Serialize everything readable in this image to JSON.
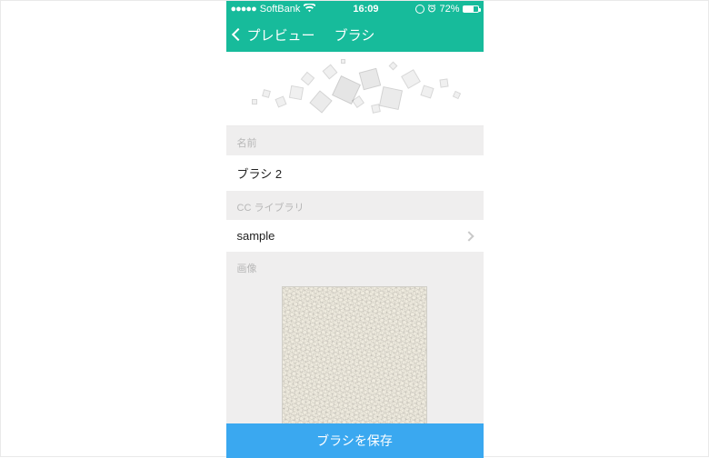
{
  "status": {
    "carrier": "SoftBank",
    "time": "16:09",
    "battery": "72%"
  },
  "nav": {
    "back_label": "プレビュー",
    "title": "ブラシ"
  },
  "sections": {
    "name_label": "名前",
    "name_value": "ブラシ 2",
    "library_label": "CC ライブラリ",
    "library_value": "sample",
    "image_label": "画像"
  },
  "bottom": {
    "save_label": "ブラシを保存"
  }
}
